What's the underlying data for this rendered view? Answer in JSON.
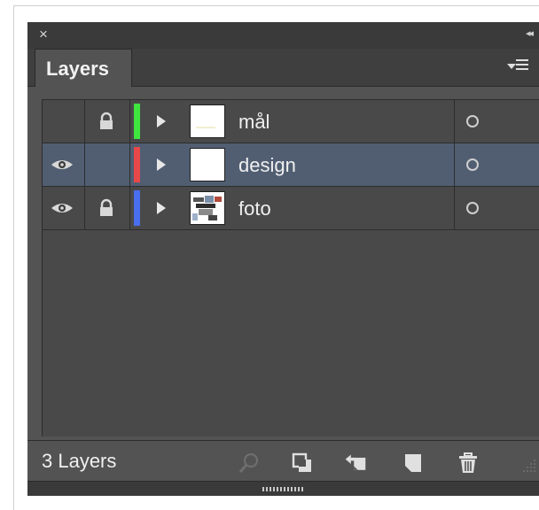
{
  "panel": {
    "close_glyph": "×",
    "collapse_glyph": "◂◂",
    "tab_label": "Layers",
    "menu_icon": "panel-menu-icon"
  },
  "layers": [
    {
      "name": "mål",
      "visible": false,
      "locked": true,
      "color": "#3ee63e",
      "selected": false,
      "thumbnail": "blank-with-faint-text"
    },
    {
      "name": "design",
      "visible": true,
      "locked": false,
      "color": "#e84848",
      "selected": true,
      "thumbnail": "blank"
    },
    {
      "name": "foto",
      "visible": true,
      "locked": true,
      "color": "#4a6ef0",
      "selected": false,
      "thumbnail": "photo"
    }
  ],
  "footer": {
    "count_label": "3 Layers",
    "icons": [
      "locate-object-icon",
      "make-clipping-mask-icon",
      "create-sublayer-icon",
      "create-new-layer-icon",
      "delete-layer-icon"
    ]
  },
  "colors": {
    "panel_bg": "#535353",
    "list_bg": "#494949",
    "selected_row": "#515e72",
    "header_bg": "#3a3a3a"
  }
}
